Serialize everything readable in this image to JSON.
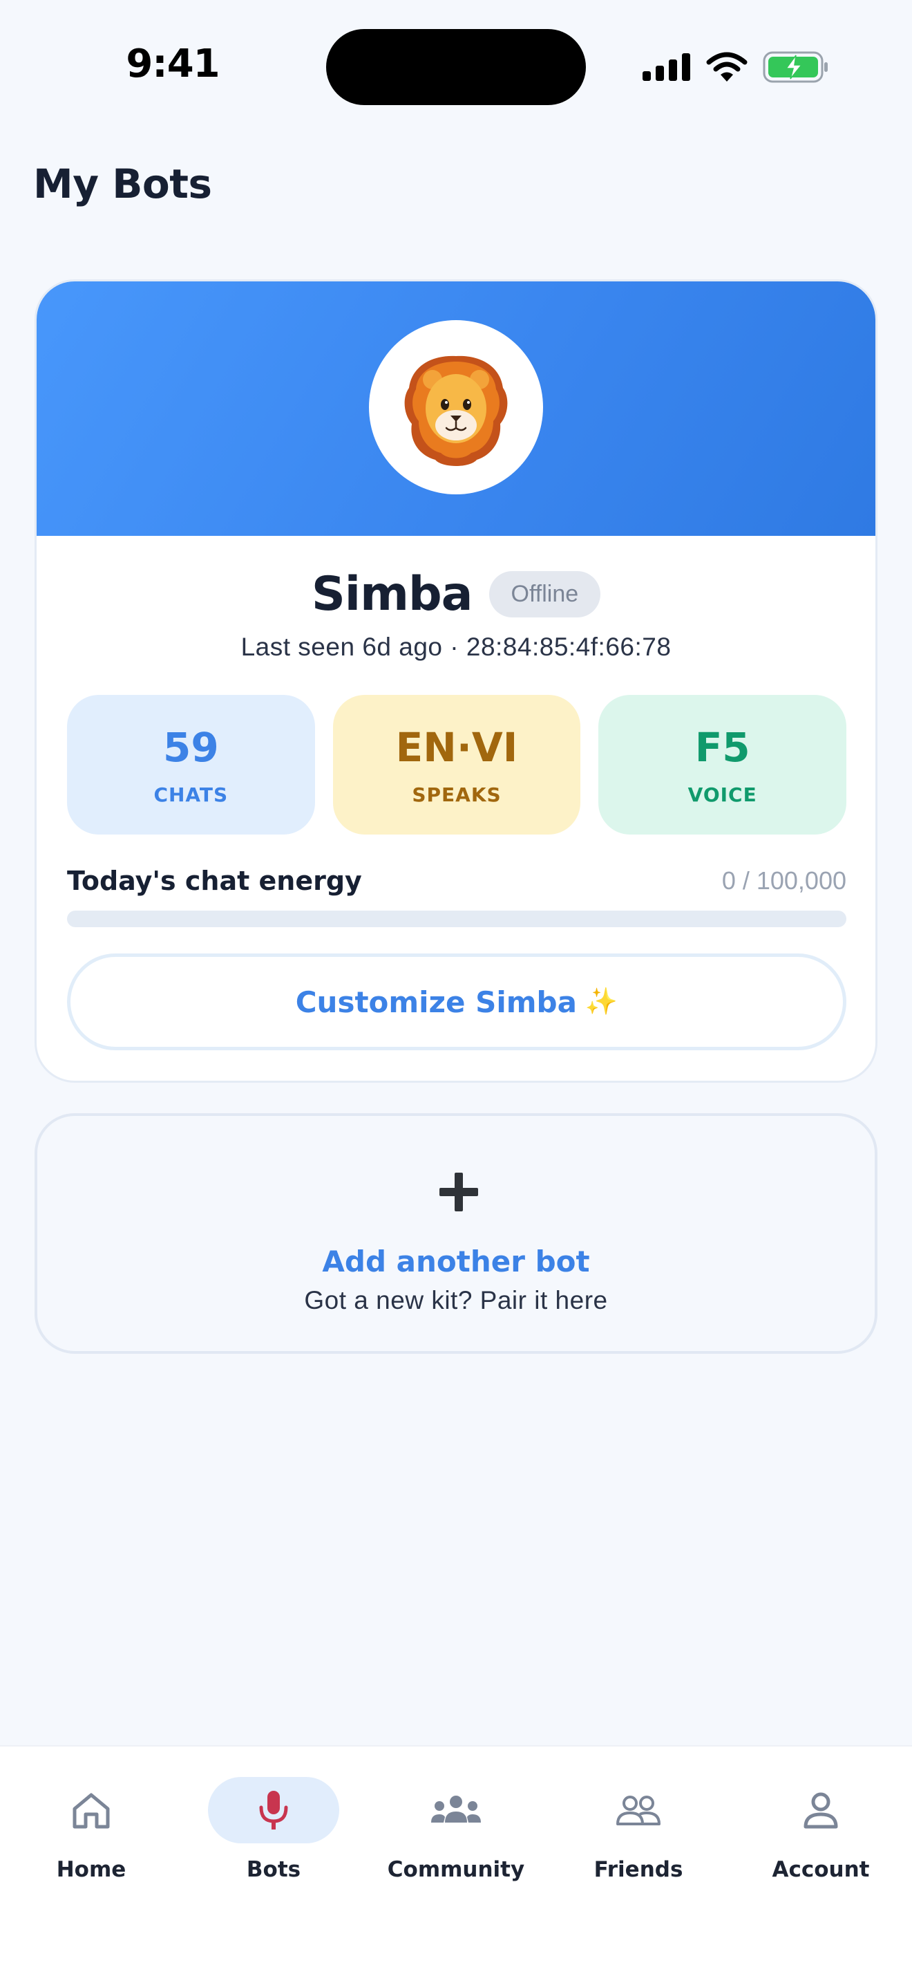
{
  "status_bar": {
    "time": "9:41",
    "icons": [
      "cellular-signal-icon",
      "wifi-icon",
      "battery-charging-icon"
    ]
  },
  "page": {
    "title": "My Bots"
  },
  "bot": {
    "name": "Simba",
    "avatar_icon": "lion-face-icon",
    "status": "Offline",
    "last_seen": "Last seen 6d ago · 28:84:85:4f:66:78",
    "stats": [
      {
        "value": "59",
        "label": "CHATS"
      },
      {
        "value": "EN·VI",
        "label": "SPEAKS"
      },
      {
        "value": "F5",
        "label": "VOICE"
      }
    ],
    "energy": {
      "label": "Today's chat energy",
      "value_text": "0 / 100,000",
      "fraction": 0
    },
    "customize_label": "Customize Simba",
    "customize_icon": "sparkles-icon"
  },
  "add_bot": {
    "icon": "plus-icon",
    "title": "Add another bot",
    "subtitle": "Got a new kit? Pair it here"
  },
  "tab_bar": {
    "active": "Bots",
    "tabs": [
      {
        "label": "Home",
        "icon": "home-icon"
      },
      {
        "label": "Bots",
        "icon": "microphone-icon"
      },
      {
        "label": "Community",
        "icon": "community-icon"
      },
      {
        "label": "Friends",
        "icon": "friends-icon"
      },
      {
        "label": "Account",
        "icon": "account-icon"
      }
    ]
  },
  "colors": {
    "background": "#f5f8fd",
    "accent": "#3c82e6",
    "banner": "#3a86ef",
    "text": "#172033",
    "chats_bg": "#e1eefd",
    "speaks_bg": "#fdf2c8",
    "speaks_text": "#a1670e",
    "voice_bg": "#dcf6ec",
    "voice_text": "#109a6c",
    "active_tab_icon": "#c8354f"
  }
}
